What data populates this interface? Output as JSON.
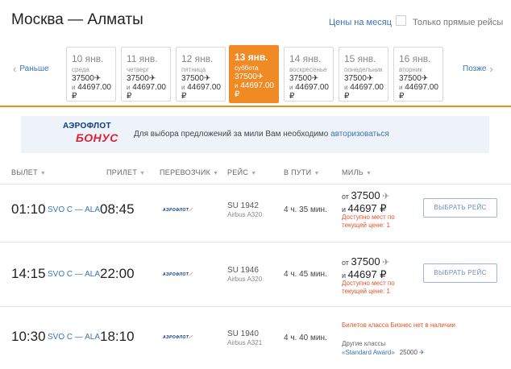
{
  "header": {
    "route_title": "Москва — Алматы",
    "month_prices_link": "Цены на месяц",
    "direct_only_label": "Только прямые рейсы"
  },
  "date_nav": {
    "prev_label": "Раньше",
    "next_label": "Позже"
  },
  "days": [
    {
      "date": "10 янв.",
      "weekday": "среда",
      "miles": "37500",
      "price": "44697.00 ₽",
      "selected": false
    },
    {
      "date": "11 янв.",
      "weekday": "четверг",
      "miles": "37500",
      "price": "44697.00 ₽",
      "selected": false
    },
    {
      "date": "12 янв.",
      "weekday": "пятница",
      "miles": "37500",
      "price": "44697.00 ₽",
      "selected": false
    },
    {
      "date": "13 янв.",
      "weekday": "суббота",
      "miles": "37500",
      "price": "44697.00 ₽",
      "selected": true
    },
    {
      "date": "14 янв.",
      "weekday": "воскресенье",
      "miles": "37500",
      "price": "44697.00 ₽",
      "selected": false
    },
    {
      "date": "15 янв.",
      "weekday": "понедельник",
      "miles": "37500",
      "price": "44697.00 ₽",
      "selected": false
    },
    {
      "date": "16 янв.",
      "weekday": "вторник",
      "miles": "37500",
      "price": "44697.00 ₽",
      "selected": false
    }
  ],
  "and_label": "и",
  "banner": {
    "logo_line1": "АЭРОФЛОТ",
    "logo_line2": "БОНУС",
    "text": "Для выбора предложений за мили Вам необходимо ",
    "login_link": "авторизоваться"
  },
  "columns": {
    "departure": "ВЫЛЕТ",
    "arrival": "ПРИЛЕТ",
    "carrier": "ПЕРЕВОЗЧИК",
    "flight": "РЕЙС",
    "duration": "В ПУТИ",
    "miles": "МИЛЬ"
  },
  "flights": [
    {
      "dep": "01:10",
      "route": "SVO C — ALA",
      "arr": "08:45",
      "carrier": "АЭРОФЛОТ",
      "flight_no": "SU 1942",
      "aircraft": "Airbus A320",
      "duration": "4 ч. 35 мин.",
      "from_label": "от",
      "miles": "37500",
      "and": "и",
      "price": "44697 ₽",
      "availability": "Доступно мест по текущей цене: 1",
      "button": "ВЫБРАТЬ РЕЙС"
    },
    {
      "dep": "14:15",
      "route": "SVO C — ALA",
      "arr": "22:00",
      "carrier": "АЭРОФЛОТ",
      "flight_no": "SU 1946",
      "aircraft": "Airbus A320",
      "duration": "4 ч. 45 мин.",
      "from_label": "от",
      "miles": "37500",
      "and": "и",
      "price": "44697 ₽",
      "availability": "Доступно мест по текущей цене: 1",
      "button": "ВЫБРАТЬ РЕЙС"
    },
    {
      "dep": "10:30",
      "route": "SVO C — ALA",
      "arr": "18:10",
      "carrier": "АЭРОФЛОТ",
      "flight_no": "SU 1940",
      "aircraft": "Airbus A321",
      "duration": "4 ч. 40 мин.",
      "business_note": "Билетов класса Бизнес нет в наличии",
      "other_classes": "Другие классы",
      "award_name": "«Standard Award»",
      "award_miles": "25000"
    }
  ],
  "colors": {
    "accent": "#f08a25",
    "link": "#3a74b8",
    "warning": "#e2562b"
  }
}
